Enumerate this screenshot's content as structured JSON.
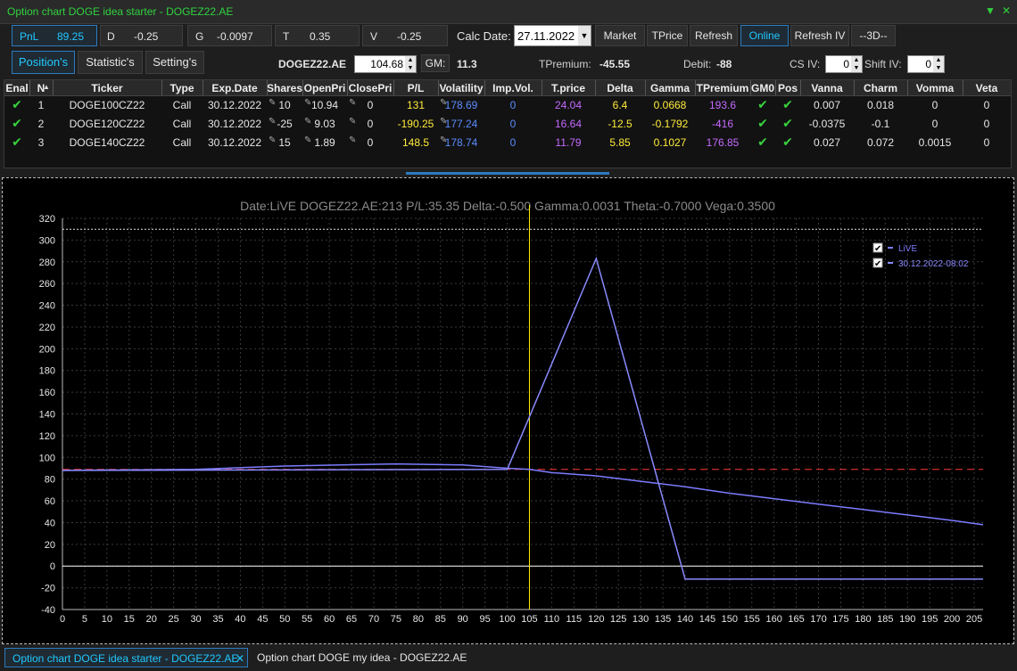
{
  "window": {
    "title": "Option chart DOGE idea starter - DOGEZ22.AE"
  },
  "stats": {
    "pnl_label": "PnL",
    "pnl_value": "89.25",
    "d_label": "D",
    "d_value": "-0.25",
    "g_label": "G",
    "g_value": "-0.0097",
    "t_label": "T",
    "t_value": "0.35",
    "v_label": "V",
    "v_value": "-0.25"
  },
  "calc": {
    "label": "Calc Date:",
    "date": "27.11.2022"
  },
  "buttons": {
    "market": "Market",
    "tprice": "TPrice",
    "refresh": "Refresh",
    "online": "Online",
    "refresh_iv": "Refresh IV",
    "three_d": "--3D--"
  },
  "tabs": {
    "positions": "Position's",
    "statistics": "Statistic's",
    "settings": "Setting's"
  },
  "summary": {
    "symbol": "DOGEZ22.AE",
    "price": "104.68",
    "gm_label": "GM:",
    "gm_value": "11.3",
    "tpremium_label": "TPremium:",
    "tpremium_value": "-45.55",
    "debit_label": "Debit:",
    "debit_value": "-88",
    "csiv_label": "CS IV:",
    "csiv_value": "0",
    "shiftiv_label": "Shift IV:",
    "shiftiv_value": "0"
  },
  "table": {
    "columns": [
      "Enal",
      "N",
      "Ticker",
      "Type",
      "Exp.Date",
      "Shares",
      "OpenPri",
      "ClosePri",
      "P/L",
      "Volatility",
      "Imp.Vol.",
      "T.price",
      "Delta",
      "Gamma",
      "TPremium",
      "GM0",
      "Pos",
      "Vanna",
      "Charm",
      "Vomma",
      "Veta"
    ],
    "rows": [
      {
        "n": "1",
        "ticker": "DOGE100CZ22",
        "type": "Call",
        "exp": "30.12.2022",
        "shares": "10",
        "open": "10.94",
        "close": "0",
        "pl": "131",
        "vol": "178.69",
        "impvol": "0",
        "tprice": "24.04",
        "delta": "6.4",
        "gamma": "0.0668",
        "tpremium": "193.6",
        "vanna": "0.007",
        "charm": "0.018",
        "vomma": "0",
        "veta": "0"
      },
      {
        "n": "2",
        "ticker": "DOGE120CZ22",
        "type": "Call",
        "exp": "30.12.2022",
        "shares": "-25",
        "open": "9.03",
        "close": "0",
        "pl": "-190.25",
        "vol": "177.24",
        "impvol": "0",
        "tprice": "16.64",
        "delta": "-12.5",
        "gamma": "-0.1792",
        "tpremium": "-416",
        "vanna": "-0.0375",
        "charm": "-0.1",
        "vomma": "0",
        "veta": "0"
      },
      {
        "n": "3",
        "ticker": "DOGE140CZ22",
        "type": "Call",
        "exp": "30.12.2022",
        "shares": "15",
        "open": "1.89",
        "close": "0",
        "pl": "148.5",
        "vol": "178.74",
        "impvol": "0",
        "tprice": "11.79",
        "delta": "5.85",
        "gamma": "0.1027",
        "tpremium": "176.85",
        "vanna": "0.027",
        "charm": "0.072",
        "vomma": "0.0015",
        "veta": "0"
      }
    ]
  },
  "chart_data": {
    "type": "line",
    "title": "Date:LiVE  DOGEZ22.AE:213  P/L:35.35  Delta:-0.500  Gamma:0.0031  Theta:-0.7000  Vega:0.3500",
    "xlim": [
      0,
      207
    ],
    "ylim": [
      -40,
      320
    ],
    "x_ticks": [
      0,
      5,
      10,
      15,
      20,
      25,
      30,
      35,
      40,
      45,
      50,
      55,
      60,
      65,
      70,
      75,
      80,
      85,
      90,
      95,
      100,
      105,
      110,
      115,
      120,
      125,
      130,
      135,
      140,
      145,
      150,
      155,
      160,
      165,
      170,
      175,
      180,
      185,
      190,
      195,
      200,
      205
    ],
    "y_ticks": [
      -40,
      -20,
      0,
      20,
      40,
      60,
      80,
      100,
      120,
      140,
      160,
      180,
      200,
      220,
      240,
      260,
      280,
      300,
      320
    ],
    "grid": true,
    "legend_position": "top-right",
    "vertical_marker_x": 105,
    "zero_line_y": 0,
    "reference_line_y": 89,
    "top_line_y": 310,
    "series": [
      {
        "name": "LiVE",
        "color": "#7c7cff",
        "x": [
          0,
          30,
          50,
          75,
          90,
          100,
          105,
          110,
          120,
          130,
          140,
          150,
          160,
          170,
          180,
          190,
          200,
          207
        ],
        "y": [
          88,
          89,
          92,
          94,
          93,
          90,
          89,
          86,
          83,
          78,
          73,
          67,
          62,
          57,
          52,
          47,
          42,
          38
        ]
      },
      {
        "name": "30.12.2022-08:02",
        "color": "#8a8aff",
        "x": [
          0,
          100,
          120,
          140,
          207
        ],
        "y": [
          88,
          89,
          283,
          -12,
          -12
        ]
      }
    ],
    "expiry_line_color": "#ff3b3b"
  },
  "bottom_tabs": [
    {
      "label": "Option chart DOGE idea starter - DOGEZ22.AE",
      "active": true
    },
    {
      "label": "Option chart DOGE my idea - DOGEZ22.AE",
      "active": false
    }
  ]
}
